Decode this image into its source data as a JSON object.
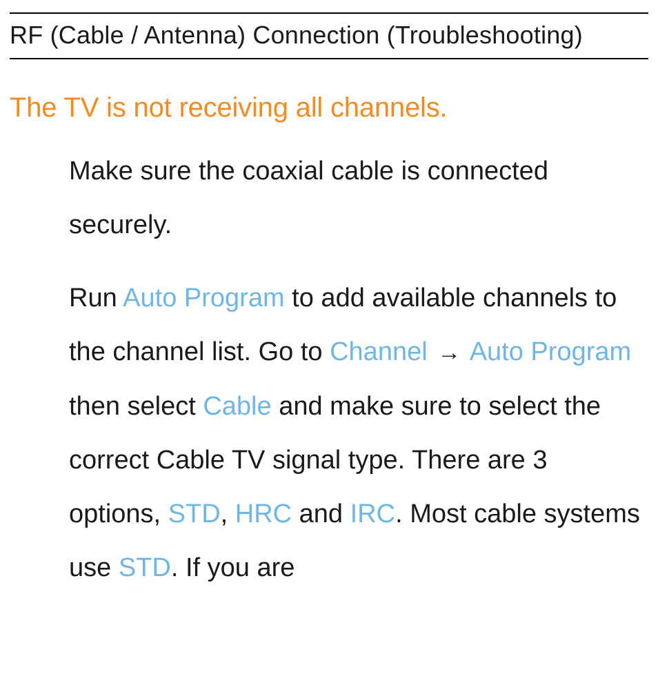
{
  "section_title": "RF (Cable / Antenna) Connection (Troubleshooting)",
  "issue_title": "The TV is not receiving all channels.",
  "para1": "Make sure the coaxial cable is connected securely.",
  "para2": {
    "t1": "Run ",
    "auto_program_1": "Auto Program",
    "t2": " to add available channels to the channel list. Go to ",
    "channel": "Channel",
    "arrow": "→",
    "auto_program_2": "Auto Program",
    "t3": " then select ",
    "cable": "Cable",
    "t4": " and make sure to select the correct Cable TV signal type. There are 3 options, ",
    "std1": "STD",
    "comma1": ", ",
    "hrc": "HRC",
    "and": " and ",
    "irc": "IRC",
    "t5": ". Most cable systems use ",
    "std2": "STD",
    "t6": ". If you are"
  }
}
